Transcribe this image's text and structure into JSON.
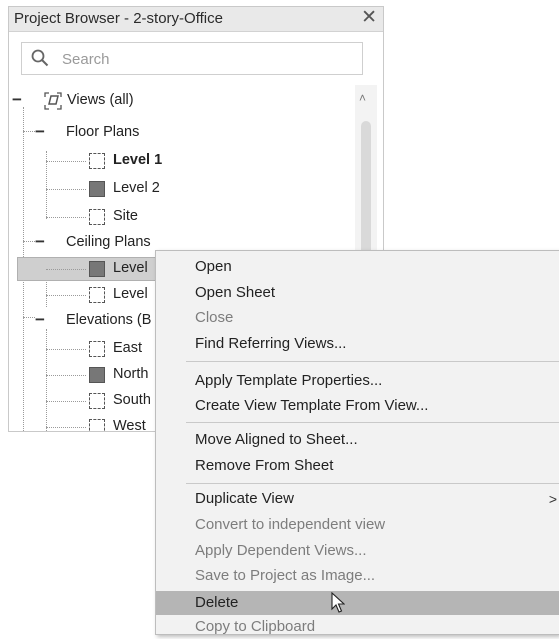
{
  "panel": {
    "title": "Project Browser - 2-story-Office",
    "close_glyph": "✕"
  },
  "search": {
    "placeholder": "Search"
  },
  "tree": {
    "root_label": "Views (all)",
    "floor_plans": {
      "label": "Floor Plans",
      "items": [
        "Level 1",
        "Level 2",
        "Site"
      ]
    },
    "ceiling_plans": {
      "label": "Ceiling Plans",
      "items": [
        "Level",
        "Level"
      ]
    },
    "elevations": {
      "label": "Elevations (B",
      "items": [
        "East",
        "North",
        "South",
        "West"
      ]
    }
  },
  "context_menu": {
    "items": [
      {
        "label": "Open",
        "enabled": true
      },
      {
        "label": "Open Sheet",
        "enabled": true
      },
      {
        "label": "Close",
        "enabled": false
      },
      {
        "label": "Find Referring Views...",
        "enabled": true
      },
      {
        "label": "Apply Template Properties...",
        "enabled": true
      },
      {
        "label": "Create View Template From View...",
        "enabled": true
      },
      {
        "label": "Move Aligned to Sheet...",
        "enabled": true
      },
      {
        "label": "Remove From Sheet",
        "enabled": true
      },
      {
        "label": "Duplicate View",
        "enabled": true,
        "submenu_arrow": ">"
      },
      {
        "label": "Convert to independent view",
        "enabled": false
      },
      {
        "label": "Apply Dependent Views...",
        "enabled": false
      },
      {
        "label": "Save to Project as Image...",
        "enabled": false
      },
      {
        "label": "Delete",
        "enabled": true,
        "highlighted": true
      },
      {
        "label": "Copy to Clipboard",
        "enabled": false
      }
    ]
  },
  "colors": {
    "menu_background": "#f2f2f2",
    "highlight": "#b5b5b5",
    "disabled_text": "#7d7d7d"
  }
}
